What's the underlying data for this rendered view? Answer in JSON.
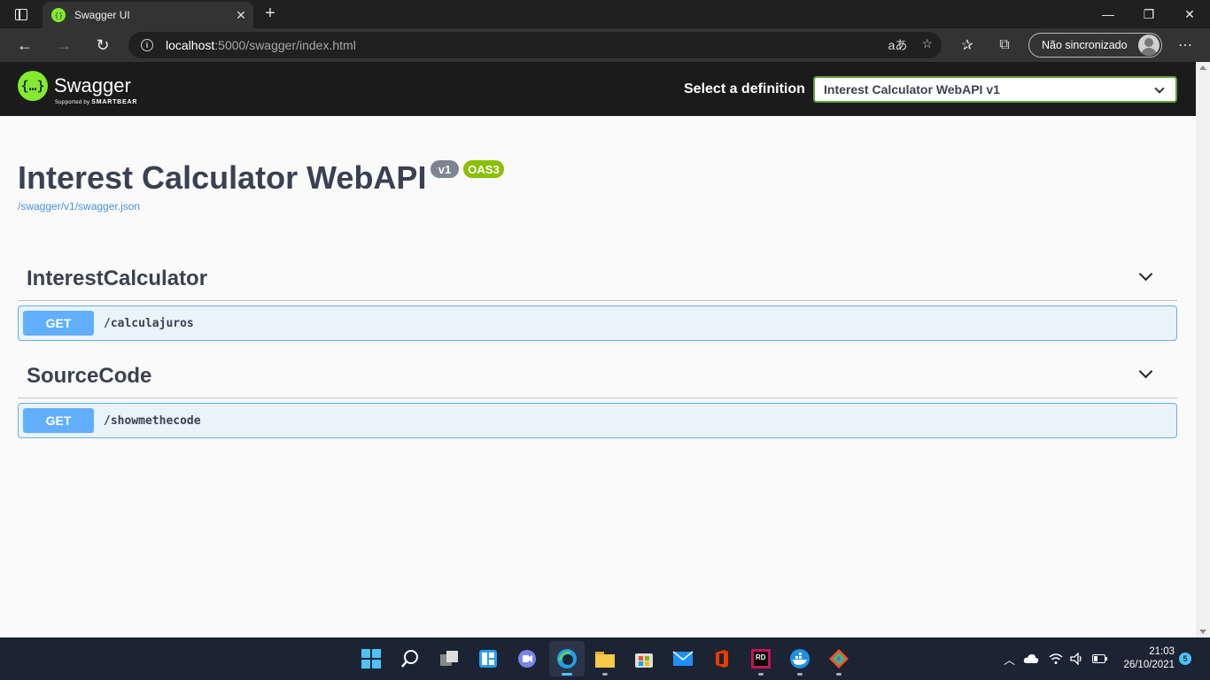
{
  "browser": {
    "tab_title": "Swagger UI",
    "tab_close": "✕",
    "new_tab": "+",
    "url_host": "localhost",
    "url_rest": ":5000/swagger/index.html",
    "profile_label": "Não sincronizado",
    "window_controls": [
      "—",
      "❐",
      "✕"
    ]
  },
  "swagger": {
    "logo_text": "Swagger",
    "logo_sub_prefix": "Supported by",
    "logo_sub_brand": "SMARTBEAR",
    "definition_label": "Select a definition",
    "definition_selected": "Interest Calculator WebAPI v1"
  },
  "api": {
    "title": "Interest Calculator WebAPI",
    "version_badge": "v1",
    "oas_badge": "OAS3",
    "spec_link": "/swagger/v1/swagger.json"
  },
  "tags": [
    {
      "name": "InterestCalculator",
      "operations": [
        {
          "method": "GET",
          "path": "/calculajuros"
        }
      ]
    },
    {
      "name": "SourceCode",
      "operations": [
        {
          "method": "GET",
          "path": "/showmethecode"
        }
      ]
    }
  ],
  "taskbar": {
    "time": "21:03",
    "date": "26/10/2021",
    "notifications": "5"
  },
  "colors": {
    "swagger_green": "#85ea2d",
    "get_blue": "#61affe",
    "oas_green": "#89bf04",
    "version_gray": "#7d8492",
    "text_dark": "#3b4151"
  }
}
